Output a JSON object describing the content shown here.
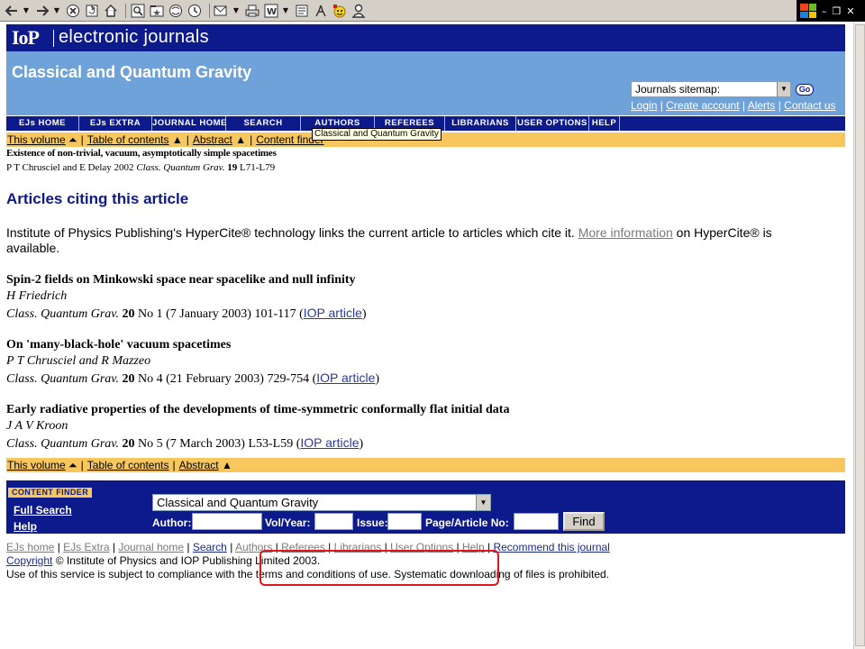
{
  "toolbar": {
    "buttons": [
      "back-icon",
      "forward-icon",
      "stop-icon",
      "refresh-icon",
      "home-icon",
      "search-icon",
      "favorites-icon",
      "media-icon",
      "history-icon",
      "mail-icon",
      "print-icon",
      "word-icon",
      "discuss-icon",
      "messenger-icon",
      "smiley-icon",
      "user-icon"
    ]
  },
  "site": {
    "logo_mark": "IoP",
    "logo_text": "electronic journals",
    "journal_title": "Classical and Quantum Gravity",
    "sitemap_value": "Journals sitemap:",
    "go_label": "Go",
    "account_links": [
      "Login",
      "Create account",
      "Alerts",
      "Contact us"
    ]
  },
  "nav": {
    "items": [
      "EJs HOME",
      "EJs EXTRA",
      "JOURNAL HOME",
      "SEARCH",
      "AUTHORS",
      "REFEREES",
      "LIBRARIANS",
      "USER OPTIONS",
      "HELP"
    ],
    "tooltip": "Classical and Quantum Gravity"
  },
  "volbar_top": {
    "links": [
      "This volume",
      "Table of contents",
      "Abstract",
      "Content finder"
    ]
  },
  "volbar_bottom": {
    "links": [
      "This volume",
      "Table of contents",
      "Abstract"
    ]
  },
  "article": {
    "title": "Existence of non-trivial, vacuum, asymptotically simple spacetimes",
    "authors_year": "P T Chrusciel and E Delay 2002",
    "journal": "Class. Quantum Grav.",
    "volume": "19",
    "pages": "L71-L79"
  },
  "heading": "Articles citing this article",
  "intro": {
    "text_before": "Institute of Physics Publishing's HyperCite® technology links the current article to articles which cite it.",
    "link": "More information",
    "text_after": "on HyperCite® is available."
  },
  "references": [
    {
      "title": "Spin-2 fields on Minkowski space near spacelike and null infinity",
      "authors": "H Friedrich",
      "journal": "Class. Quantum Grav.",
      "volume": "20",
      "details": "No 1 (7 January 2003) 101-117 (",
      "link": "IOP article",
      "close": ")"
    },
    {
      "title": "On 'many-black-hole' vacuum spacetimes",
      "authors": "P T Chrusciel and R Mazzeo",
      "journal": "Class. Quantum Grav.",
      "volume": "20",
      "details": "No 4 (21 February 2003) 729-754 (",
      "link": "IOP article",
      "close": ")"
    },
    {
      "title": "Early radiative properties of the developments of time-symmetric conformally flat initial data",
      "authors": "J A V Kroon",
      "journal": "Class. Quantum Grav.",
      "volume": "20",
      "details": "No 5 (7 March 2003) L53-L59 (",
      "link": "IOP article",
      "close": ")"
    }
  ],
  "content_finder": {
    "label": "CONTENT FINDER",
    "full_search": "Full Search",
    "help": "Help",
    "journal_value": "Classical and Quantum Gravity",
    "author_label": "Author:",
    "volyear_label": "Vol/Year:",
    "issue_label": "Issue:",
    "page_label": "Page/Article No:",
    "author_value": "",
    "volyear_value": "",
    "issue_value": "",
    "page_value": "",
    "find_label": "Find"
  },
  "footer": {
    "links": [
      "EJs home",
      "EJs Extra",
      "Journal home",
      "Search",
      "Authors",
      "Referees",
      "Librarians",
      "User Options",
      "Help",
      "Recommend this journal"
    ],
    "copyright_link": "Copyright",
    "copyright_text": "© Institute of Physics and IOP Publishing Limited 2003.",
    "terms": "Use of this service is subject to compliance with the terms and conditions of use. Systematic downloading of files is prohibited."
  },
  "colors": {
    "brand_dark_blue": "#0d1a8c",
    "header_blue": "#6fa2d8",
    "volume_bar": "#f7c75e",
    "highlight_red": "#e0151b"
  }
}
